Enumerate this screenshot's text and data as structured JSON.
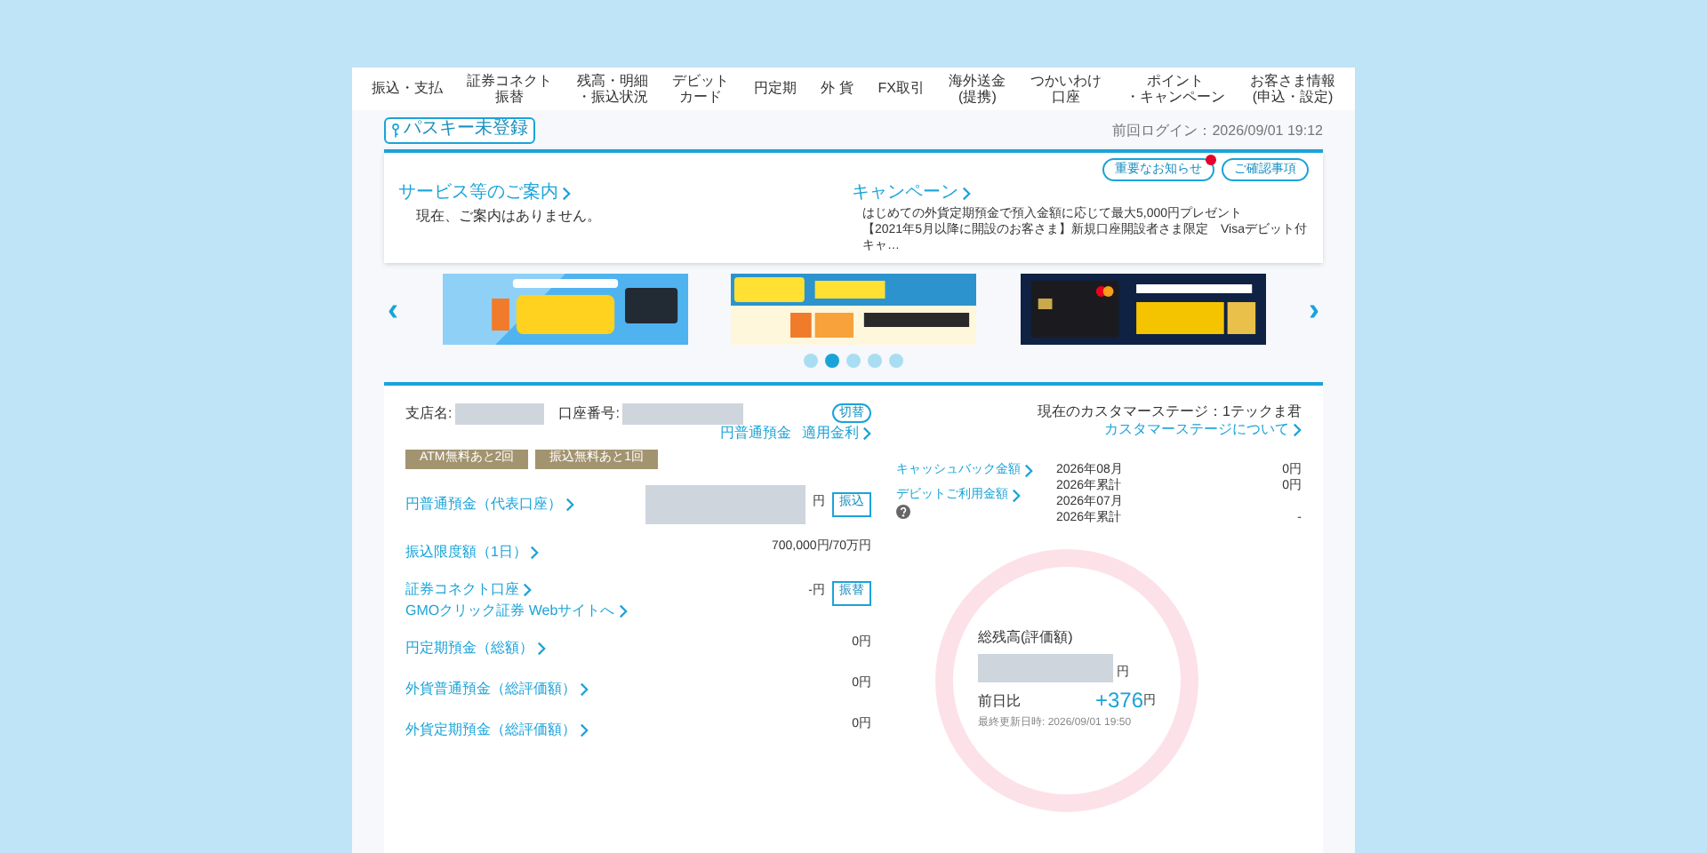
{
  "nav": [
    {
      "lines": [
        "振込・支払"
      ]
    },
    {
      "lines": [
        "証券コネクト",
        "振替"
      ]
    },
    {
      "lines": [
        "残高・明細",
        "・振込状況"
      ]
    },
    {
      "lines": [
        "デビット",
        "カード"
      ]
    },
    {
      "lines": [
        "円定期"
      ]
    },
    {
      "lines": [
        "外 貨"
      ]
    },
    {
      "lines": [
        "FX取引"
      ]
    },
    {
      "lines": [
        "海外送金",
        "(提携)"
      ]
    },
    {
      "lines": [
        "つかいわけ",
        "口座"
      ]
    },
    {
      "lines": [
        "ポイント",
        "・キャンペーン"
      ]
    },
    {
      "lines": [
        "お客さま情報",
        "(申込・設定)"
      ]
    }
  ],
  "passkey": {
    "label": "パスキー未登録"
  },
  "last_login": "前回ログイン：2026/09/01 19:12",
  "notices": {
    "buttons": [
      {
        "label": "重要なお知らせ",
        "unread": true
      },
      {
        "label": "ご確認事項",
        "unread": false
      }
    ],
    "service": {
      "heading": "サービス等のご案内",
      "text": "現在、ご案内はありません。"
    },
    "campaign": {
      "heading": "キャンペーン",
      "items": [
        "はじめての外貨定期預金で預入金額に応じて最大5,000円プレゼント",
        "【2021年5月以降に開設のお客さま】新規口座開設者さま限定　Visaデビット付キャ…"
      ]
    }
  },
  "carousel": {
    "prev": "‹",
    "next": "›",
    "dots": [
      {
        "selected": false
      },
      {
        "selected": true
      },
      {
        "selected": false
      },
      {
        "selected": false
      },
      {
        "selected": false
      }
    ]
  },
  "account": {
    "branch_label": "支店名:",
    "number_label": "口座番号:",
    "switch_button": "切替",
    "links": [
      "円普通預金",
      "適用金利"
    ],
    "badges": [
      "ATM無料あと2回",
      "振込無料あと1回"
    ],
    "rows": [
      {
        "label": "円普通預金（代表口座）",
        "masked": true,
        "value": "円",
        "button": "振込"
      },
      {
        "label": "振込限度額（1日）",
        "masked": false,
        "value": "700,000円/70万円"
      },
      {
        "label": "証券コネクト口座",
        "masked": false,
        "value": "-円",
        "button": "振替",
        "sublink": "GMOクリック証券 Webサイトへ"
      },
      {
        "label": "円定期預金（総額）",
        "masked": false,
        "value": "0円"
      },
      {
        "label": "外貨普通預金（総評価額）",
        "masked": false,
        "value": "0円"
      },
      {
        "label": "外貨定期預金（総評価額）",
        "masked": false,
        "value": "0円"
      }
    ]
  },
  "stage": {
    "text": "現在のカスタマーステージ：1テックま君",
    "link": "カスタマーステージについて"
  },
  "debit": {
    "links": [
      "キャッシュバック金額",
      "デビットご利用金額"
    ],
    "rows": [
      {
        "period": "2026年08月",
        "value": "0円"
      },
      {
        "period": "2026年累計",
        "value": "0円"
      },
      {
        "period": "2026年07月"
      },
      {
        "period": "2026年累計",
        "value": "-"
      }
    ]
  },
  "balance": {
    "label": "総残高(評価額)",
    "masked": true,
    "unit": "円",
    "change_label": "前日比",
    "change": "+376",
    "change_unit": "円",
    "updated": "最終更新日時: 2026/09/01 19:50"
  }
}
